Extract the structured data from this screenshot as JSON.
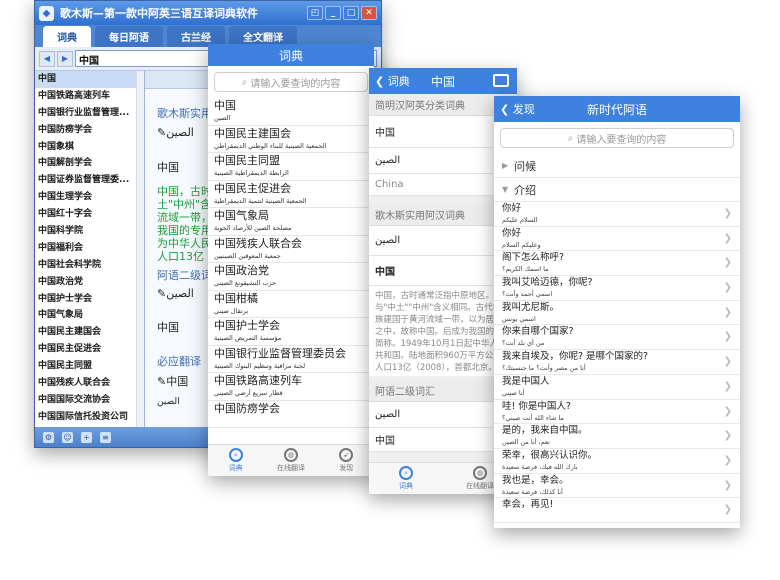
{
  "window": {
    "title": "歌木斯—第一款中阿英三语互译词典软件",
    "tabs": [
      "词典",
      "每日阿语",
      "古兰经",
      "全文翻译"
    ],
    "search_value": "中国",
    "word_list": [
      "中国",
      "中国铁路高速列车",
      "中国银行业监督管理...",
      "中国防痨学会",
      "中国象棋",
      "中国解剖学会",
      "中国证券监督管理委...",
      "中国生理学会",
      "中国红十字会",
      "中国科学院",
      "中国福利会",
      "中国社会科学院",
      "中国政治党",
      "中国护士学会",
      "中国气象局",
      "中国民主建国会",
      "中国民主促进会",
      "中国民主同盟",
      "中国残疾人联合会",
      "中国国际交流协会",
      "中国国际信托投资公司"
    ],
    "detail": {
      "section1": "歌木斯实用",
      "sound1": "الصين",
      "word1": "中国",
      "green_lines": [
        "中国，古时",
        "土\"中州\"含义",
        "流域一带，",
        "我国的专用",
        "为中华人民共",
        "人口13亿（"
      ],
      "section2": "阿语二级词",
      "sound2": "الصين",
      "word2": "中国",
      "section3": "必应翻译",
      "sound3": "中国",
      "ar3": "الصين"
    }
  },
  "phone1": {
    "title": "词典",
    "search_placeholder": "请输入要查询的内容",
    "entries": [
      {
        "zh": "中国",
        "ar": "الصين"
      },
      {
        "zh": "中国民主建国会",
        "ar": "الجمعية الصينية للبناء الوطني الديمقراطي"
      },
      {
        "zh": "中国民主同盟",
        "ar": "الرابطة الديمقراطية الصينية"
      },
      {
        "zh": "中国民主促进会",
        "ar": "الجمعية الصينية لتنمية الديمقراطية"
      },
      {
        "zh": "中国气象局",
        "ar": "مصلحة الصين للأرصاد الجوية"
      },
      {
        "zh": "中国残疾人联合会",
        "ar": "جمعية المعوقين الصينيين"
      },
      {
        "zh": "中国政治党",
        "ar": "حزب التشيقونغ الصيني"
      },
      {
        "zh": "中国柑橘",
        "ar": "برتقال صيني"
      },
      {
        "zh": "中国护士学会",
        "ar": "مؤسسة التمريض الصينية"
      },
      {
        "zh": "中国银行业监督管理委员会",
        "ar": "لجنة مراقبة وتنظيم البنوك الصينية"
      },
      {
        "zh": "中国铁路高速列车",
        "ar": "قطار سريع أرضي الصيني"
      },
      {
        "zh": "中国防痨学会",
        "ar": ""
      }
    ],
    "tabs": [
      "词典",
      "在线翻译",
      "发现"
    ]
  },
  "phone2": {
    "back": "词典",
    "title": "中国",
    "section1": "简明汉阿英分类词典",
    "row1": "中国",
    "row2": "الصين",
    "row3": "China",
    "section2": "歌木斯实用阿汉词典",
    "row4": "الصين",
    "row5": "中国",
    "paragraph": "中国，古时通常泛指中原地区。与\"中土\"\"中州\"含义相同。古代华夏族建国于黄河流域一带，以为居天下之中，故称中国。后成为我国的专用简称。1949年10月1日起中华人民共和国。陆地面积960万平方公里，人口13亿（2008），首都北京。",
    "section3": "阿语二级词汇",
    "row6": "الصين",
    "row7": "中国",
    "tabs": [
      "词典",
      "在线翻译"
    ]
  },
  "phone3": {
    "back": "发现",
    "title": "新时代阿语",
    "search_placeholder": "请输入要查询的内容",
    "categories": [
      "问候",
      "介绍"
    ],
    "phrases": [
      {
        "zh": "你好",
        "ar": "السلام عليكم"
      },
      {
        "zh": "你好",
        "ar": "وعليكم السلام"
      },
      {
        "zh": "阁下怎么称呼?",
        "ar": "ما اسمك الكريم؟"
      },
      {
        "zh": "我叫艾哈迈德，你呢?",
        "ar": "اسمي أحمد وأنت؟"
      },
      {
        "zh": "我叫尤尼斯。",
        "ar": "اسمي يونس"
      },
      {
        "zh": "你来自哪个国家?",
        "ar": "من أي بلد أنت؟"
      },
      {
        "zh": "我来自埃及，你呢? 是哪个国家的?",
        "ar": "أنا من مصر وأنت؟ ما جنسيتك؟"
      },
      {
        "zh": "我是中国人",
        "ar": "أنا صيني"
      },
      {
        "zh": "哇! 你是中国人?",
        "ar": "ما شاء الله أنت صيني؟"
      },
      {
        "zh": "是的，我来自中国。",
        "ar": "نعم، أنا من الصين"
      },
      {
        "zh": "荣幸，很高兴认识你。",
        "ar": "بارك الله فيك، فرصة سعيدة"
      },
      {
        "zh": "我也是，幸会。",
        "ar": "أنا كذلك، فرصة سعيدة"
      },
      {
        "zh": "幸会，再见!",
        "ar": ""
      }
    ]
  }
}
